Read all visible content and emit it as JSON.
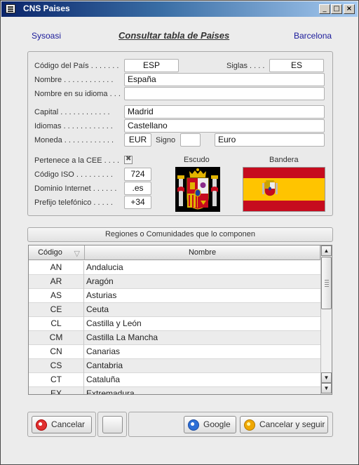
{
  "window": {
    "title": "CNS Paises",
    "controls": {
      "minimize": "_",
      "maximize": "□",
      "close": "×"
    }
  },
  "header": {
    "left": "Sysoasi",
    "title": "Consultar tabla de Paises",
    "right": "Barcelona"
  },
  "country": {
    "codigo_label": "Código del País . . . . . . .",
    "codigo": "ESP",
    "siglas_label": "Siglas . . . .",
    "siglas": "ES",
    "nombre_label": "Nombre . . . . . . . . . . . .",
    "nombre": "España",
    "nombre_idioma_label": "Nombre en su idioma . . .",
    "nombre_idioma": "",
    "capital_label": "Capital . . . . . . . . . . . .",
    "capital": "Madrid",
    "idiomas_label": "Idiomas . . . . . . . . . . . .",
    "idiomas": "Castellano",
    "moneda_label": "Moneda . . . . . . . . . . . .",
    "moneda_code": "EUR",
    "signo_label": "Signo",
    "signo": "",
    "moneda_name": "Euro",
    "cee_label": "Pertenece a la CEE . . . .",
    "cee_checked": true,
    "iso_label": "Código ISO . . . . . . . . .",
    "iso": "724",
    "dominio_label": "Dominio Internet . . . . . .",
    "dominio": ".es",
    "prefijo_label": "Prefijo telefónico . . . . .",
    "prefijo": "+34",
    "escudo_label": "Escudo",
    "bandera_label": "Bandera"
  },
  "regions": {
    "section_title": "Regiones o Comunidades que lo componen",
    "columns": {
      "code": "Código",
      "name": "Nombre"
    },
    "rows": [
      {
        "code": "AN",
        "name": "Andalucia"
      },
      {
        "code": "AR",
        "name": "Aragón"
      },
      {
        "code": "AS",
        "name": "Asturias"
      },
      {
        "code": "CE",
        "name": "Ceuta"
      },
      {
        "code": "CL",
        "name": "Castilla y León"
      },
      {
        "code": "CM",
        "name": "Castilla La Mancha"
      },
      {
        "code": "CN",
        "name": "Canarias"
      },
      {
        "code": "CS",
        "name": "Cantabria"
      },
      {
        "code": "CT",
        "name": "Cataluña"
      },
      {
        "code": "EX",
        "name": "Extremadura"
      }
    ]
  },
  "footer": {
    "cancel_label": "Cancelar",
    "blank_label": "",
    "google_label": "Google",
    "cancel_continue_label": "Cancelar y seguir"
  },
  "colors": {
    "flag_red": "#c60b1e",
    "flag_yellow": "#ffc400",
    "title_bar": "#0a246a"
  }
}
